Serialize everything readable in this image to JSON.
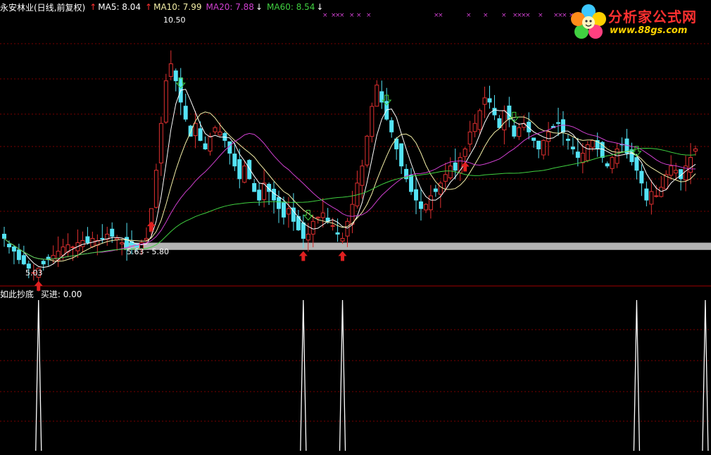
{
  "header": {
    "title": "永安林业(日线,前复权)",
    "ma5": "MA5: 8.04",
    "ma10": "MA10: 7.99",
    "ma20": "MA20: 7.88",
    "ma60": "MA60: 8.54",
    "ma5_arrow": "↑",
    "ma10_arrow": "↑",
    "ma20_arrow": "↓",
    "ma60_arrow": "↓"
  },
  "logo": {
    "name": "分析家公式网",
    "url": "www.88gs.com"
  },
  "annotations": {
    "high": "10.50",
    "low": "5.03",
    "range": "5.63 - 5.80"
  },
  "indicator": {
    "name": "如此抄底",
    "value_label": "买进: 0.00"
  },
  "colors": {
    "up": "#e03030",
    "down": "#54e3f5",
    "ma5": "#ffffff",
    "ma10": "#f5f0a8",
    "ma20": "#d040d0",
    "ma60": "#40d040",
    "grid": "#7a0000",
    "band": "#b4b4b4",
    "marker": "#d040d0"
  },
  "chart_data": [
    {
      "type": "candlestick",
      "title": "永安林业(日线,前复权)",
      "ylim": [
        4.8,
        11.2
      ],
      "price_band": [
        5.63,
        5.8
      ],
      "high_marker": 10.5,
      "low_marker": 5.03,
      "series": [
        {
          "name": "MA5",
          "last": 8.04
        },
        {
          "name": "MA10",
          "last": 7.99
        },
        {
          "name": "MA20",
          "last": 7.88
        },
        {
          "name": "MA60",
          "last": 8.54
        }
      ],
      "closes": [
        5.9,
        5.7,
        5.6,
        5.4,
        5.3,
        5.2,
        5.1,
        5.2,
        5.3,
        5.4,
        5.5,
        5.6,
        5.7,
        5.75,
        5.7,
        5.8,
        5.85,
        5.8,
        5.9,
        5.85,
        5.9,
        6.0,
        5.95,
        5.9,
        5.8,
        5.7,
        5.75,
        5.7,
        5.8,
        5.9,
        6.6,
        7.5,
        8.6,
        9.6,
        10.0,
        9.6,
        9.1,
        8.7,
        8.3,
        8.6,
        8.2,
        8.0,
        8.3,
        8.5,
        8.4,
        8.2,
        7.9,
        7.6,
        7.3,
        7.6,
        7.3,
        7.0,
        6.8,
        7.2,
        7.0,
        6.8,
        6.6,
        6.4,
        6.6,
        6.3,
        6.1,
        5.9,
        6.0,
        6.3,
        6.4,
        6.5,
        6.3,
        6.2,
        6.0,
        5.9,
        6.3,
        6.7,
        7.2,
        7.6,
        8.3,
        9.0,
        9.5,
        9.1,
        8.7,
        8.4,
        8.0,
        7.6,
        7.3,
        7.0,
        6.8,
        6.6,
        6.7,
        6.9,
        7.0,
        7.2,
        7.4,
        7.6,
        7.5,
        7.8,
        8.0,
        8.4,
        8.6,
        8.9,
        9.2,
        9.1,
        8.8,
        8.5,
        8.9,
        8.7,
        8.3,
        8.5,
        8.6,
        8.4,
        8.2,
        8.0,
        8.2,
        8.4,
        8.5,
        8.6,
        8.4,
        8.2,
        8.0,
        7.8,
        7.9,
        8.1,
        8.2,
        8.0,
        7.8,
        7.6,
        7.8,
        8.0,
        8.1,
        7.9,
        7.7,
        7.5,
        7.2,
        6.8,
        7.0,
        6.9,
        7.1,
        7.4,
        7.6,
        7.5,
        7.3,
        7.6,
        7.8,
        8.0
      ]
    },
    {
      "type": "line",
      "title": "如此抄底",
      "ylim": [
        0,
        1
      ],
      "signal_indices": [
        7,
        61,
        69,
        129,
        143
      ],
      "last_value": 0.0
    }
  ]
}
